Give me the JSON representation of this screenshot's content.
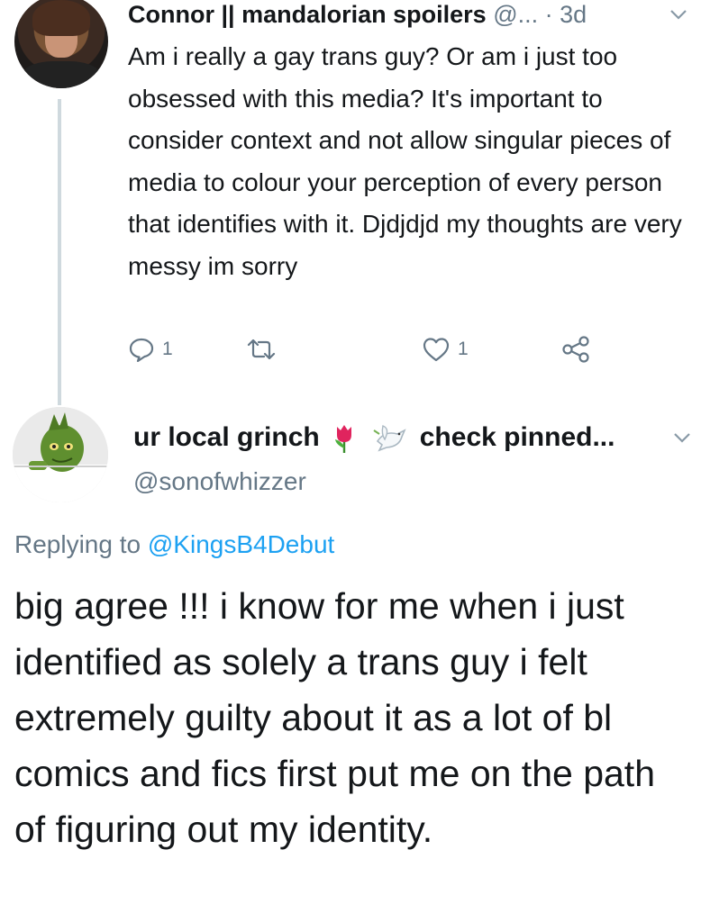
{
  "tweet1": {
    "display_name": "Connor || mandalorian spoilers",
    "handle_truncated": "@...",
    "separator": "·",
    "time": "3d",
    "body": "Am i really a gay trans guy? Or am i just too obsessed with this media? It's important to consider context and not allow singular pieces of media to colour your perception of every person that identifies with it. Djdjdjd my thoughts are very messy im sorry",
    "reply_count": "1",
    "like_count": "1"
  },
  "tweet2": {
    "display_name_start": "ur local grinch",
    "display_name_end": "check pinned...",
    "handle": "@sonofwhizzer",
    "replying_prefix": "Replying to",
    "replying_mention": "@KingsB4Debut",
    "body": "big agree !!! i know for me when i just identified as solely a trans guy i felt extremely guilty about it as a lot of bl comics and fics first put me on the path of figuring out my identity."
  },
  "icons": [
    "avatar",
    "chevron-down-icon",
    "reply-icon",
    "retweet-icon",
    "like-icon",
    "share-icon",
    "tulip-emoji",
    "dove-emoji"
  ],
  "colors": {
    "text": "#14171a",
    "secondary": "#657786",
    "link": "#1da1f2",
    "thread": "#cfd9de"
  }
}
